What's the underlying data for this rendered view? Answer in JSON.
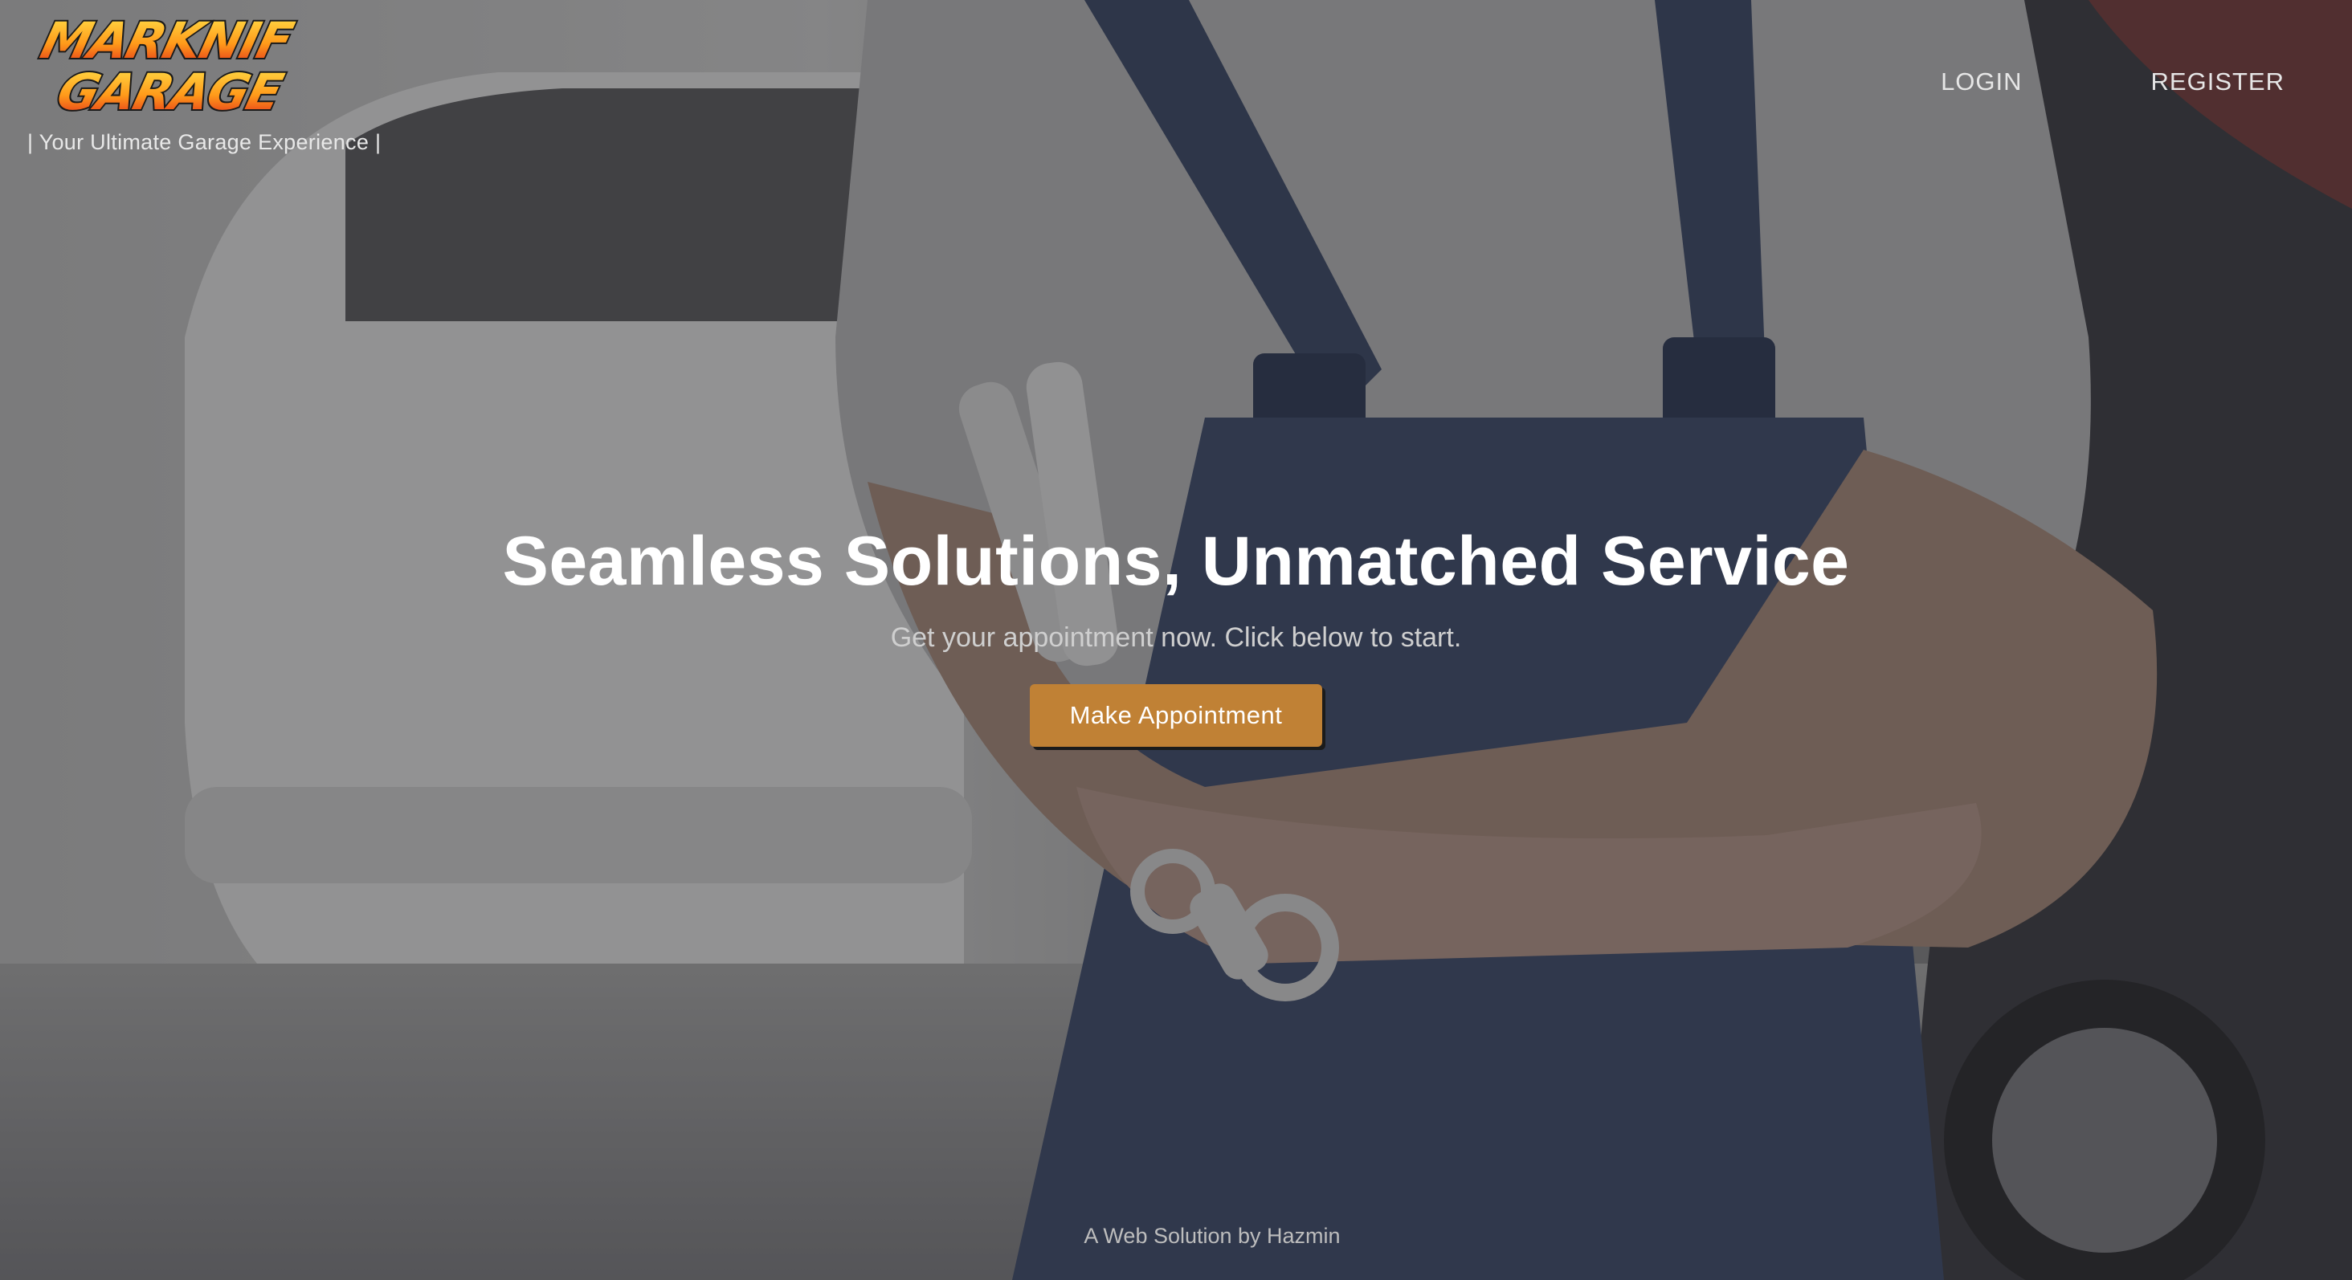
{
  "brand": {
    "logo_text_line1": "MARKNIF",
    "logo_text_line2": "GARAGE",
    "tagline": "| Your Ultimate Garage Experience |"
  },
  "nav": {
    "login": "LOGIN",
    "register": "REGISTER"
  },
  "hero": {
    "headline": "Seamless Solutions, Unmatched Service",
    "subline": "Get your appointment now. Click below to start.",
    "cta_label": "Make Appointment"
  },
  "footer": {
    "credit": "A Web Solution by Hazmin"
  },
  "colors": {
    "cta_background": "#c08135",
    "overlay": "#1e1e22",
    "logo_yellow": "#ffd200",
    "logo_red": "#e0261b"
  },
  "icons": {
    "logo": "marknif-garage-logo"
  }
}
